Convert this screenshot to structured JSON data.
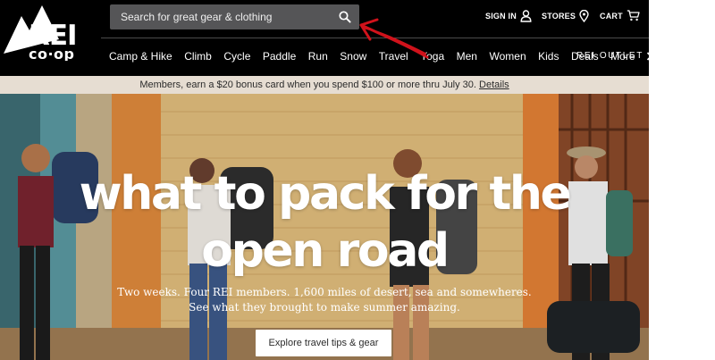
{
  "header": {
    "brand": "REI co-op",
    "search": {
      "placeholder": "Search for great gear & clothing",
      "icon": "search-icon"
    },
    "utility": [
      {
        "label": "SIGN IN",
        "icon": "user-icon"
      },
      {
        "label": "STORES",
        "icon": "location-pin-icon"
      },
      {
        "label": "CART",
        "icon": "cart-icon"
      }
    ],
    "nav": [
      "Camp & Hike",
      "Climb",
      "Cycle",
      "Paddle",
      "Run",
      "Snow",
      "Travel",
      "Yoga",
      "Men",
      "Women",
      "Kids",
      "Deals",
      "More"
    ],
    "outlet": "REI OUTLET",
    "colors": {
      "header_bg": "#000000",
      "search_bg": "#555557"
    }
  },
  "promo": {
    "text": "Members, earn a $20 bonus card when you spend $100 or more thru July 30.",
    "link": "Details"
  },
  "hero": {
    "headline_line1": "what to pack for the",
    "headline_line2": "open road",
    "subtext_line1": "Two weeks. Four REI members. 1,600 miles of desert, sea and somewheres.",
    "subtext_line2": "See what they brought to make summer amazing.",
    "cta": "Explore travel tips & gear"
  },
  "annotation": {
    "color": "#d0121b",
    "icon": "hand-drawn-arrow"
  }
}
